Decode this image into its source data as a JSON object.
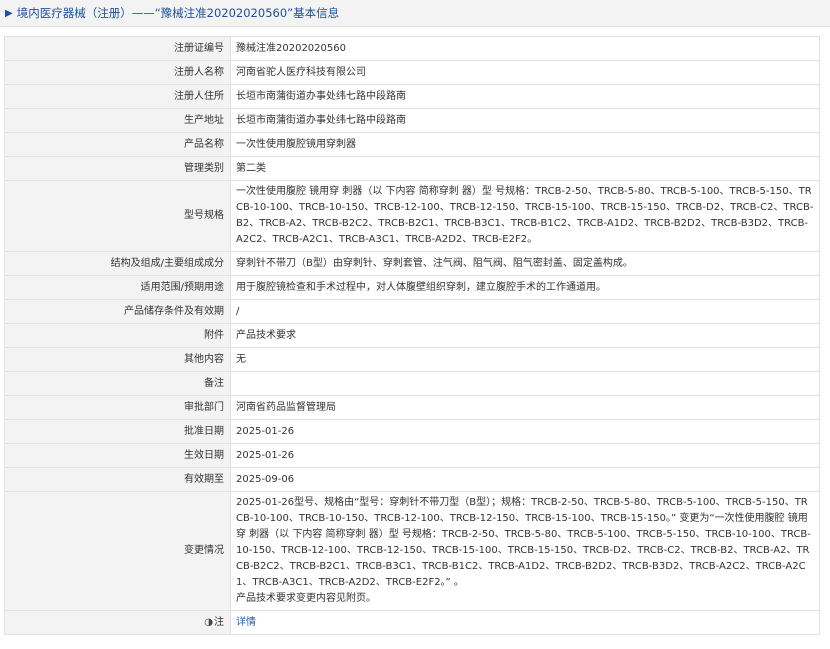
{
  "header": {
    "icon": "caret-right-icon",
    "title": "境内医疗器械（注册）——“豫械注准20202020560”基本信息"
  },
  "rows": [
    {
      "label": "注册证编号",
      "value": "豫械注准20202020560"
    },
    {
      "label": "注册人名称",
      "value": "河南省驼人医疗科技有限公司"
    },
    {
      "label": "注册人住所",
      "value": "长垣市南蒲街道办事处纬七路中段路南"
    },
    {
      "label": "生产地址",
      "value": "长垣市南蒲街道办事处纬七路中段路南"
    },
    {
      "label": "产品名称",
      "value": "一次性使用腹腔镜用穿刺器"
    },
    {
      "label": "管理类别",
      "value": "第二类"
    },
    {
      "label": "型号规格",
      "value": "一次性使用腹腔 镜用穿 刺器（以 下内容 简称穿刺 器）型 号规格：TRCB-2-50、TRCB-5-80、TRCB-5-100、TRCB-5-150、TRCB-10-100、TRCB-10-150、TRCB-12-100、TRCB-12-150、TRCB-15-100、TRCB-15-150、TRCB-D2、TRCB-C2、TRCB-B2、TRCB-A2、TRCB-B2C2、TRCB-B2C1、TRCB-B3C1、TRCB-B1C2、TRCB-A1D2、TRCB-B2D2、TRCB-B3D2、TRCB-A2C2、TRCB-A2C1、TRCB-A3C1、TRCB-A2D2、TRCB-E2F2。"
    },
    {
      "label": "结构及组成/主要组成成分",
      "value": "穿刺针不带刀（B型）由穿刺针、穿刺套管、注气阀、阻气阀、阻气密封盖、固定盖构成。"
    },
    {
      "label": "适用范围/预期用途",
      "value": "用于腹腔镜检查和手术过程中，对人体腹壁组织穿刺，建立腹腔手术的工作通道用。"
    },
    {
      "label": "产品储存条件及有效期",
      "value": "/"
    },
    {
      "label": "附件",
      "value": "产品技术要求"
    },
    {
      "label": "其他内容",
      "value": "无"
    },
    {
      "label": "备注",
      "value": ""
    },
    {
      "label": "审批部门",
      "value": "河南省药品监督管理局"
    },
    {
      "label": "批准日期",
      "value": "2025-01-26"
    },
    {
      "label": "生效日期",
      "value": "2025-01-26"
    },
    {
      "label": "有效期至",
      "value": "2025-09-06"
    },
    {
      "label": "变更情况",
      "value": "2025-01-26型号、规格由“型号：穿刺针不带刀型（B型）；规格：TRCB-2-50、TRCB-5-80、TRCB-5-100、TRCB-5-150、TRCB-10-100、TRCB-10-150、TRCB-12-100、TRCB-12-150、TRCB-15-100、TRCB-15-150。” 变更为“一次性使用腹腔 镜用穿 刺器（以 下内容 简称穿刺 器）型 号规格：TRCB-2-50、TRCB-5-80、TRCB-5-100、TRCB-5-150、TRCB-10-100、TRCB-10-150、TRCB-12-100、TRCB-12-150、TRCB-15-100、TRCB-15-150、TRCB-D2、TRCB-C2、TRCB-B2、TRCB-A2、TRCB-B2C2、TRCB-B2C1、TRCB-B3C1、TRCB-B1C2、TRCB-A1D2、TRCB-B2D2、TRCB-B3D2、TRCB-A2C2、TRCB-A2C1、TRCB-A3C1、TRCB-A2D2、TRCB-E2F2。” 。",
      "value_line2": "产品技术要求变更内容见附页。"
    }
  ],
  "note_row": {
    "icon": "globe-icon",
    "label": "注",
    "link": "详情"
  }
}
